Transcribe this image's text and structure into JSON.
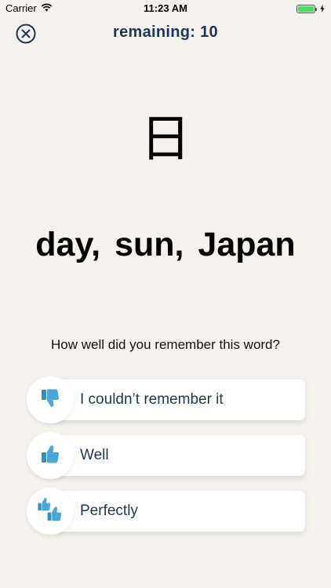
{
  "status_bar": {
    "carrier": "Carrier",
    "time": "11:23 AM",
    "battery_level": 1.0
  },
  "header": {
    "remaining_label": "remaining: 10"
  },
  "card": {
    "kanji": "日",
    "meaning": "day, sun, Japan"
  },
  "question": "How well did you remember this word?",
  "options": [
    {
      "label": "I couldn’t remember it",
      "icon": "thumbs-down-icon"
    },
    {
      "label": "Well",
      "icon": "thumbs-up-icon"
    },
    {
      "label": "Perfectly",
      "icon": "double-thumbs-up-icon"
    }
  ],
  "colors": {
    "background": "#f5f2ee",
    "accent_navy": "#1f3658",
    "icon_blue": "#4aa8d8",
    "battery_green": "#4cd964"
  }
}
